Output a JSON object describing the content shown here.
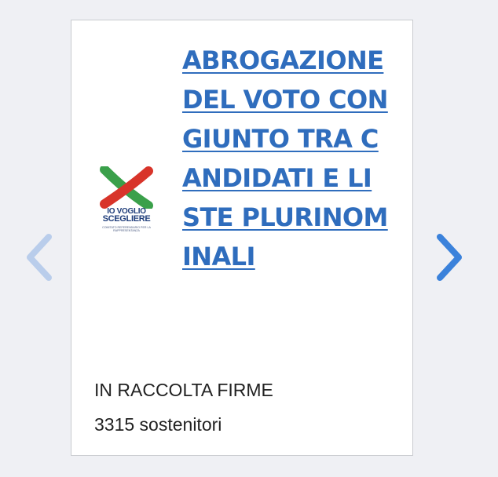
{
  "card": {
    "title": "ABROGAZIONE DEL VOTO CONGIUNTO TRA CANDIDATI E LISTE PLURINOMINALI",
    "status": "IN RACCOLTA FIRME",
    "supporters": "3315 sostenitori"
  },
  "logo": {
    "line1": "IO VOGLIO",
    "line2": "SCEGLIERE",
    "line3": "COMITATO REFERENDARIO PER LA RAPPRESENTANZA",
    "colors": {
      "green": "#3aa04a",
      "red": "#d8342a",
      "text": "#1f3d7a"
    }
  },
  "carousel": {
    "prev_icon": "chevron-left-icon",
    "next_icon": "chevron-right-icon",
    "prev_color": "#b9cdeb",
    "next_color": "#3b82db"
  },
  "colors": {
    "background": "#eff0f4",
    "link": "#2f6dbd",
    "text": "#222222"
  }
}
